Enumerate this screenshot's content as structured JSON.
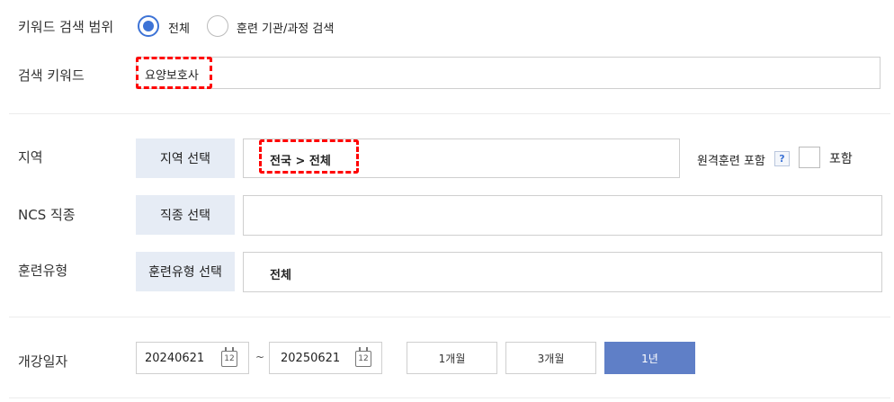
{
  "keyword_scope": {
    "label": "키워드 검색 범위",
    "options": [
      {
        "label": "전체",
        "selected": true
      },
      {
        "label": "훈련 기관/과정 검색",
        "selected": false
      }
    ]
  },
  "keyword": {
    "label": "검색 키워드",
    "value": "요양보호사"
  },
  "region": {
    "label": "지역",
    "button_label": "지역 선택",
    "value": "전국 > 전체",
    "remote_label": "원격훈련 포함",
    "help_icon": "?",
    "include_label": "포함"
  },
  "ncs": {
    "label": "NCS 직종",
    "button_label": "직종 선택",
    "value": ""
  },
  "training_type": {
    "label": "훈련유형",
    "button_label": "훈련유형 선택",
    "value": "전체"
  },
  "open_date": {
    "label": "개강일자",
    "start": "20240621",
    "end": "20250621",
    "separator": "~",
    "calendar_icon_text": "12",
    "periods": [
      {
        "label": "1개월",
        "active": false
      },
      {
        "label": "3개월",
        "active": false
      },
      {
        "label": "1년",
        "active": true
      }
    ]
  },
  "colors": {
    "accent": "#3d73d6",
    "active_button": "#5f7fc7",
    "select_button_bg": "#e6ecf5",
    "highlight_dash": "#ff0000"
  }
}
